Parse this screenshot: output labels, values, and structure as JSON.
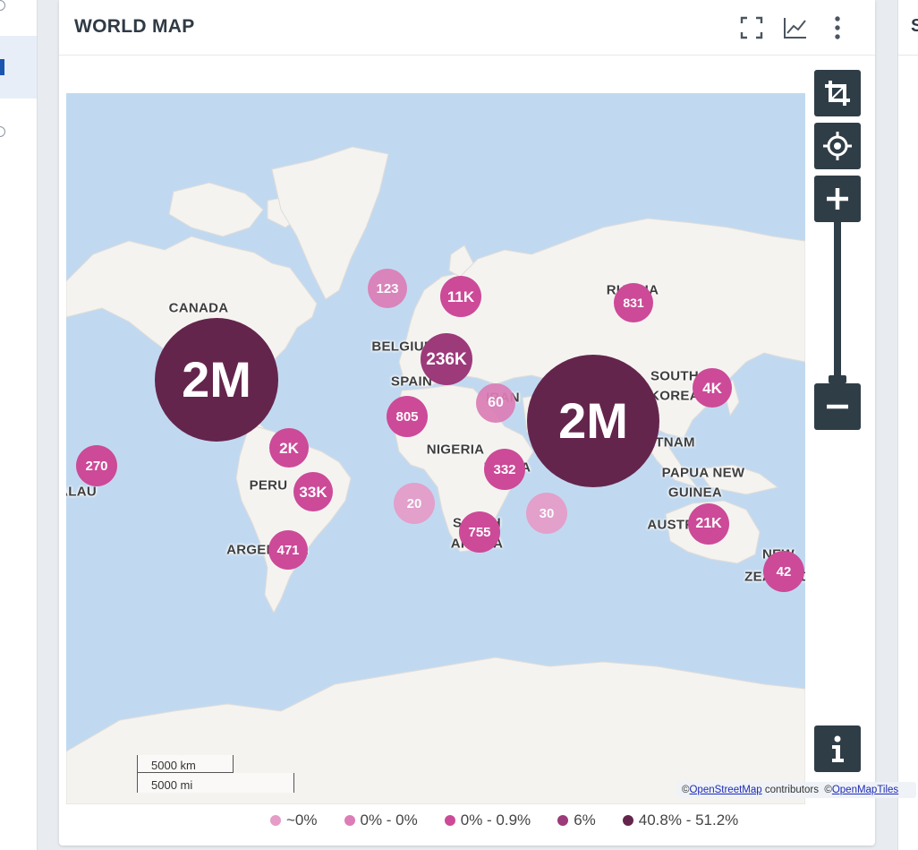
{
  "card": {
    "title": "WORLD MAP",
    "icons": [
      "fullscreen-icon",
      "line-chart-icon",
      "more-vertical-icon"
    ]
  },
  "right_panel": {
    "title_partial": "S"
  },
  "map": {
    "country_labels": [
      {
        "name": "canada",
        "text": "CANADA"
      },
      {
        "name": "russia",
        "text": "RUSSIA"
      },
      {
        "name": "belgium",
        "text": "BELGIUM"
      },
      {
        "name": "spain",
        "text": "SPAIN"
      },
      {
        "name": "nigeria",
        "text": "NIGERIA"
      },
      {
        "name": "kenya",
        "text": "KENYA"
      },
      {
        "name": "peru",
        "text": "PERU"
      },
      {
        "name": "argentina",
        "text": "ARGENTINA"
      },
      {
        "name": "south-africa-1",
        "text": "SOUTH"
      },
      {
        "name": "south-africa-2",
        "text": "AFRICA"
      },
      {
        "name": "australia",
        "text": "AUSTRALIA"
      },
      {
        "name": "papua-1",
        "text": "PAPUA NEW"
      },
      {
        "name": "papua-2",
        "text": "GUINEA"
      },
      {
        "name": "south-korea-1",
        "text": "SOUTH"
      },
      {
        "name": "south-korea-2",
        "text": "KOREA"
      },
      {
        "name": "vietnam",
        "text": "VIETNAM"
      },
      {
        "name": "palau",
        "text": "PALAU"
      },
      {
        "name": "new-zealand-1",
        "text": "NEW"
      },
      {
        "name": "new-zealand-2",
        "text": "ZEALAND"
      },
      {
        "name": "iran",
        "text": "IRAN"
      }
    ],
    "clusters": [
      {
        "label": "2M",
        "tier": 4
      },
      {
        "label": "2M",
        "tier": 4
      },
      {
        "label": "236K",
        "tier": 3
      },
      {
        "label": "123",
        "tier": 1
      },
      {
        "label": "11K",
        "tier": 2
      },
      {
        "label": "831",
        "tier": 2
      },
      {
        "label": "60",
        "tier": 1
      },
      {
        "label": "4K",
        "tier": 2
      },
      {
        "label": "805",
        "tier": 2
      },
      {
        "label": "2K",
        "tier": 2
      },
      {
        "label": "270",
        "tier": 2
      },
      {
        "label": "33K",
        "tier": 2
      },
      {
        "label": "332",
        "tier": 2
      },
      {
        "label": "20",
        "tier": 0
      },
      {
        "label": "30",
        "tier": 0
      },
      {
        "label": "755",
        "tier": 2
      },
      {
        "label": "471",
        "tier": 2
      },
      {
        "label": "21K",
        "tier": 2
      },
      {
        "label": "42",
        "tier": 2
      }
    ],
    "controls": [
      "crop-icon",
      "crosshair-icon",
      "zoom-in-icon",
      "zoom-out-icon",
      "info-icon"
    ],
    "scale": {
      "km": "5000 km",
      "mi": "5000 mi"
    },
    "attribution": {
      "prefix1": "©",
      "link1": "OpenStreetMap",
      "mid": " contributors  ©",
      "link2": "OpenMapTiles"
    }
  },
  "colors": {
    "tier0": "#e59cc7",
    "tier1": "#dc7db6",
    "tier2": "#cc4a98",
    "tier3": "#9c3a7a",
    "tier4": "#64254c",
    "water": "#c1d9f0",
    "land": "#f5f3f0",
    "control": "#2f3d47"
  },
  "legend": [
    {
      "label": "~0%",
      "color": "#e59cc7"
    },
    {
      "label": "0% - 0%",
      "color": "#dc7db6"
    },
    {
      "label": "0% - 0.9%",
      "color": "#cc4a98"
    },
    {
      "label": "6%",
      "color": "#9c3a7a"
    },
    {
      "label": "40.8% - 51.2%",
      "color": "#64254c"
    }
  ]
}
